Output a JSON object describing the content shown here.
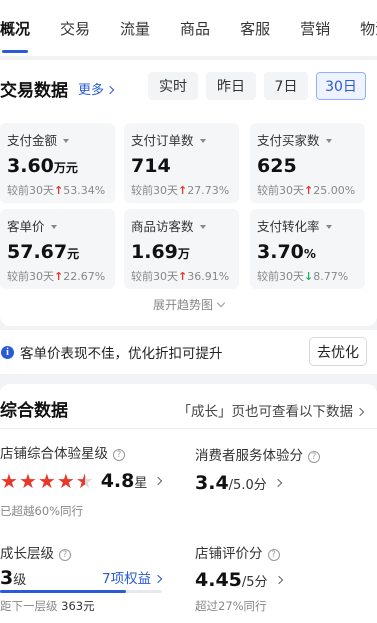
{
  "nav": {
    "tabs": [
      "概况",
      "交易",
      "流量",
      "商品",
      "客服",
      "营销",
      "物流"
    ],
    "active_index": 0
  },
  "trade": {
    "title": "交易数据",
    "more": "更多",
    "ranges": [
      "实时",
      "昨日",
      "7日",
      "30日"
    ],
    "active_range": "30日",
    "metrics": [
      {
        "label": "支付金额",
        "value": "3.60",
        "unit": "万元",
        "compare_prefix": "较前30天",
        "direction": "up",
        "change": "53.34%"
      },
      {
        "label": "支付订单数",
        "value": "714",
        "unit": "",
        "compare_prefix": "较前30天",
        "direction": "up",
        "change": "27.73%"
      },
      {
        "label": "支付买家数",
        "value": "625",
        "unit": "",
        "compare_prefix": "较前30天",
        "direction": "up",
        "change": "25.00%"
      },
      {
        "label": "客单价",
        "value": "57.67",
        "unit": "元",
        "compare_prefix": "较前30天",
        "direction": "up",
        "change": "22.67%"
      },
      {
        "label": "商品访客数",
        "value": "1.69",
        "unit": "万",
        "compare_prefix": "较前30天",
        "direction": "up",
        "change": "36.91%"
      },
      {
        "label": "支付转化率",
        "value": "3.70",
        "unit": "%",
        "compare_prefix": "较前30天",
        "direction": "down",
        "change": "8.77%"
      }
    ],
    "expand_label": "展开趋势图"
  },
  "tip": {
    "icon": "i",
    "text": "客单价表现不佳，优化折扣可提升",
    "button": "去优化"
  },
  "composite": {
    "title": "综合数据",
    "link": "「成长」页也可查看以下数据",
    "store_rating": {
      "label": "店铺综合体验星级",
      "stars": 4.5,
      "score": "4.8",
      "score_unit": "星",
      "note": "已超越60%同行"
    },
    "service": {
      "label": "消费者服务体验分",
      "score": "3.4",
      "score_sub": "/5.0分"
    },
    "growth": {
      "label": "成长层级",
      "level": "3",
      "level_unit": "级",
      "benefits": "7项权益",
      "progress_fraction": 0.78,
      "note_prefix": "距下一层级",
      "note_value": "363元"
    },
    "review": {
      "label": "店铺评价分",
      "score": "4.45",
      "score_sub": "/5分",
      "note": "超过27%同行"
    }
  }
}
